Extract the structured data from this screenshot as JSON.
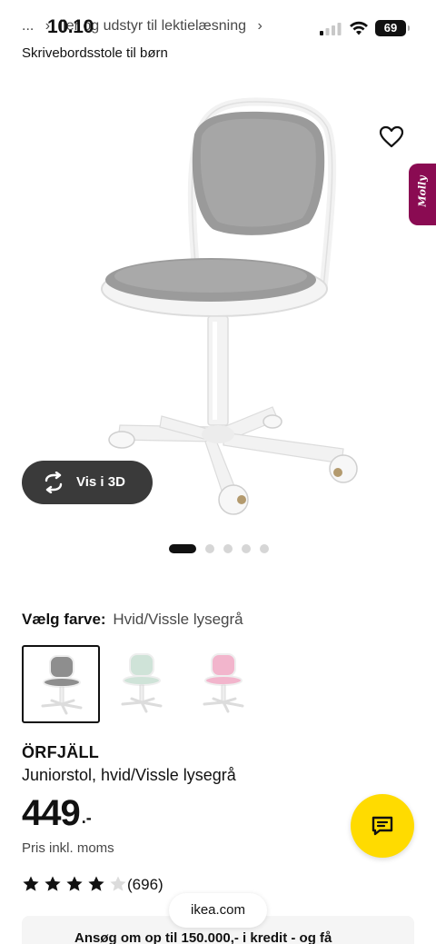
{
  "status_bar": {
    "time": "10.10",
    "battery": "69"
  },
  "breadcrumb": {
    "ellipsis": "...",
    "text": "ller og udstyr til lektielæsning"
  },
  "category_link": "Skrivebordsstole til børn",
  "hero": {
    "view_3d_label": "Vis i 3D",
    "molly_label": "Molly",
    "carousel": {
      "total": 5,
      "active_index": 0
    }
  },
  "color": {
    "heading_label": "Vælg farve:",
    "selected_value": "Hvid/Vissle lysegrå",
    "swatches": [
      {
        "seat_color": "#8e8e8e",
        "selected": true
      },
      {
        "seat_color": "#cfe3d8",
        "selected": false
      },
      {
        "seat_color": "#f2b5cc",
        "selected": false
      }
    ]
  },
  "product": {
    "name": "ÖRFJÄLL",
    "description": "Juniorstol, hvid/Vissle lysegrå",
    "price_main": "449",
    "price_decimal": ".-",
    "vat_note": "Pris inkl. moms",
    "rating": {
      "value": 4,
      "max": 5
    },
    "review_count": "(696)"
  },
  "browser": {
    "url": "ikea.com"
  },
  "credit_banner": {
    "text": "Ansøg om op til 150.000,- i kredit - og få"
  },
  "colors": {
    "accent_yellow": "#ffdb00",
    "molly_magenta": "#8a0b52",
    "dark_button": "#3a3a3a"
  }
}
